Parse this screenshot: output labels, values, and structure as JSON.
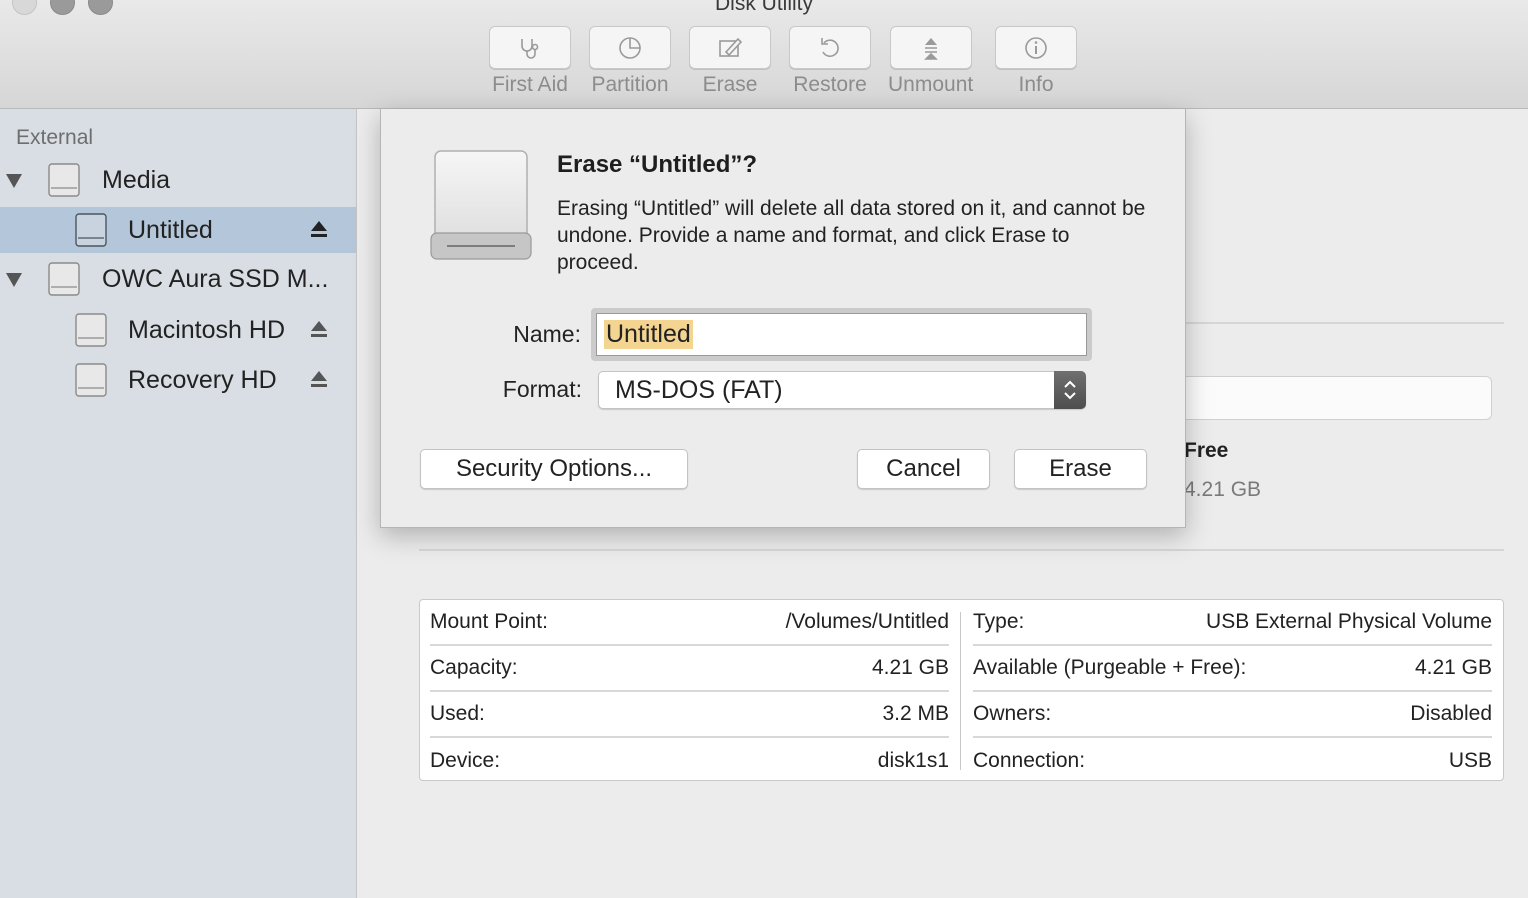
{
  "window": {
    "title": "Disk Utility"
  },
  "toolbar": {
    "items": [
      {
        "label": "First Aid",
        "icon": "stethoscope-icon"
      },
      {
        "label": "Partition",
        "icon": "pie-chart-icon"
      },
      {
        "label": "Erase",
        "icon": "pencil-icon"
      },
      {
        "label": "Restore",
        "icon": "undo-arrow-icon"
      },
      {
        "label": "Unmount",
        "icon": "eject-icon"
      },
      {
        "label": "Info",
        "icon": "info-icon"
      }
    ]
  },
  "sidebar": {
    "section": "External",
    "items": [
      {
        "label": "Media",
        "level": 0,
        "expanded": true
      },
      {
        "label": "Untitled",
        "level": 1,
        "selected": true,
        "ejectable": true
      },
      {
        "label": "OWC Aura SSD M...",
        "level": 0,
        "expanded": true
      },
      {
        "label": "Macintosh HD",
        "level": 1,
        "ejectable": true
      },
      {
        "label": "Recovery HD",
        "level": 1,
        "ejectable": true
      }
    ]
  },
  "background": {
    "free_label": "Free",
    "free_value": "4.21 GB"
  },
  "info_table": {
    "left": [
      {
        "label": "Mount Point:",
        "value": "/Volumes/Untitled"
      },
      {
        "label": "Capacity:",
        "value": "4.21 GB"
      },
      {
        "label": "Used:",
        "value": "3.2 MB"
      },
      {
        "label": "Device:",
        "value": "disk1s1"
      }
    ],
    "right": [
      {
        "label": "Type:",
        "value": "USB External Physical Volume"
      },
      {
        "label": "Available (Purgeable + Free):",
        "value": "4.21 GB"
      },
      {
        "label": "Owners:",
        "value": "Disabled"
      },
      {
        "label": "Connection:",
        "value": "USB"
      }
    ]
  },
  "dialog": {
    "title": "Erase “Untitled”?",
    "message": "Erasing “Untitled” will delete all data stored on it, and cannot be undone. Provide a name and format, and click Erase to proceed.",
    "name_label": "Name:",
    "name_value": "Untitled",
    "format_label": "Format:",
    "format_value": "MS-DOS (FAT)",
    "security_button": "Security Options...",
    "cancel_button": "Cancel",
    "erase_button": "Erase"
  },
  "colors": {
    "selection": "#b4c6d9",
    "sidebar_bg": "#d9dee4",
    "text_highlight": "#f4d491"
  }
}
